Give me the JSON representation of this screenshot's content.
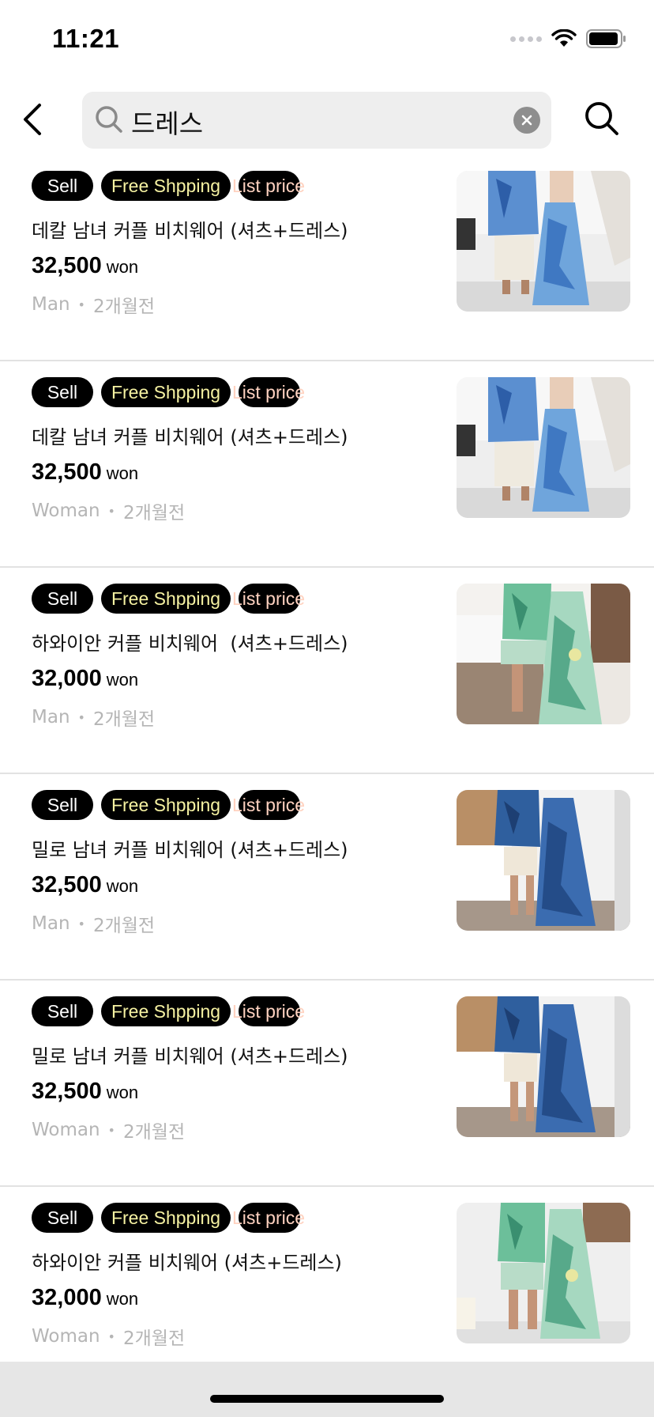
{
  "status": {
    "time": "11:21"
  },
  "search": {
    "query": "드레스"
  },
  "badges": {
    "sell": "Sell",
    "shipping": "Free Shpping",
    "list_price": "List price"
  },
  "items": [
    {
      "title": "데칼 남녀 커플 비치웨어 (셔츠+드레스)",
      "price": "32,500",
      "currency": "won",
      "gender": "Man",
      "time_ago": "2개월전",
      "image": "blue-floral-couple-stairs"
    },
    {
      "title": "데칼 남녀 커플 비치웨어 (셔츠+드레스)",
      "price": "32,500",
      "currency": "won",
      "gender": "Woman",
      "time_ago": "2개월전",
      "image": "blue-floral-couple-stairs"
    },
    {
      "title": "하와이안 커플 비치웨어  (셔츠+드레스)",
      "price": "32,000",
      "currency": "won",
      "gender": "Man",
      "time_ago": "2개월전",
      "image": "green-tropical-couple-bed"
    },
    {
      "title": "밀로 남녀 커플 비치웨어 (셔츠+드레스)",
      "price": "32,500",
      "currency": "won",
      "gender": "Man",
      "time_ago": "2개월전",
      "image": "navy-floral-couple-bedroom"
    },
    {
      "title": "밀로 남녀 커플 비치웨어 (셔츠+드레스)",
      "price": "32,500",
      "currency": "won",
      "gender": "Woman",
      "time_ago": "2개월전",
      "image": "navy-floral-couple-bedroom"
    },
    {
      "title": "하와이안 커플 비치웨어 (셔츠+드레스)",
      "price": "32,000",
      "currency": "won",
      "gender": "Woman",
      "time_ago": "2개월전",
      "image": "green-tropical-couple-standing"
    }
  ],
  "colors": {
    "badge_bg": "#000000",
    "shipping_text": "#f6f2a2",
    "list_price_text": "#ffd2c0",
    "meta_text": "#b5b5b5",
    "divider": "#e2e2e2",
    "search_bg": "#eeeeee"
  }
}
